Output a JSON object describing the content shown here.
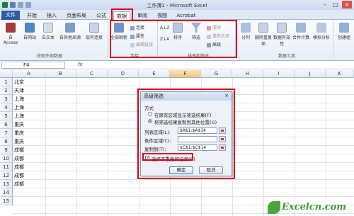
{
  "window": {
    "title": "工作簿1 - Microsoft Excel",
    "controls": [
      "–",
      "□",
      "×"
    ]
  },
  "tabs": [
    {
      "label": "文件"
    },
    {
      "label": "开始"
    },
    {
      "label": "插入"
    },
    {
      "label": "页面布局"
    },
    {
      "label": "公式"
    },
    {
      "label": "数据",
      "active": true
    },
    {
      "label": "审阅"
    },
    {
      "label": "视图"
    },
    {
      "label": "Acrobat"
    }
  ],
  "ribbon": {
    "ext_buttons": [
      "自 Access",
      "自网站",
      "自文本",
      "自其他来源",
      "现有连接"
    ],
    "ext_group_label": "获取外部数据",
    "refresh_label": "全部刷新",
    "conn_small": [
      "连接",
      "属性",
      "编辑链接"
    ],
    "conn_group_label": "连接",
    "sort_asc_label": "A↓Z",
    "sort_desc_label": "Z↓A",
    "sort_label": "排序",
    "filter_label": "筛选",
    "filter_small": [
      "清除",
      "重新应用",
      "高级"
    ],
    "sortfilter_group_label": "排序和筛选",
    "tools_buttons": [
      "分列",
      "删除重复项",
      "数据有效性",
      "合并计算",
      "模拟分析"
    ],
    "tools_group_label": "数据工具",
    "outline_buttons": [
      "创建组"
    ]
  },
  "formula_bar": {
    "name_box": "F4",
    "fx": "fx"
  },
  "columns": [
    "A",
    "B",
    "C",
    "D",
    "E",
    "F",
    "G",
    "H",
    "I",
    "J",
    "K"
  ],
  "selected_column": "F",
  "rows": [
    "1",
    "2",
    "3",
    "4",
    "5",
    "6",
    "7",
    "8",
    "9",
    "10",
    "11",
    "12",
    "13",
    "14",
    "15"
  ],
  "column_a": [
    "北京",
    "天津",
    "上海",
    "上海",
    "上海",
    "重庆",
    "重庆",
    "重庆",
    "成都",
    "成都",
    "成都",
    "成都",
    "成都",
    "",
    ""
  ],
  "dialog": {
    "title": "高级筛选",
    "close": "×",
    "method_label": "方式",
    "option1": "在原有区域显示筛选结果(F)",
    "option2": "将筛选结果复制到其他位置(O)",
    "list_range_label": "列表区域(L):",
    "list_range_value": "$A$1:$A$14",
    "criteria_range_label": "条件区域(C):",
    "criteria_range_value": "",
    "copy_to_label": "复制到(T):",
    "copy_to_value": "$C$1:$C$14",
    "unique_label": "选择不重复的记录(R)",
    "unique_checked": "✓",
    "ok_label": "确定",
    "cancel_label": "取消"
  },
  "logo": {
    "text": "Excelcn.com"
  }
}
